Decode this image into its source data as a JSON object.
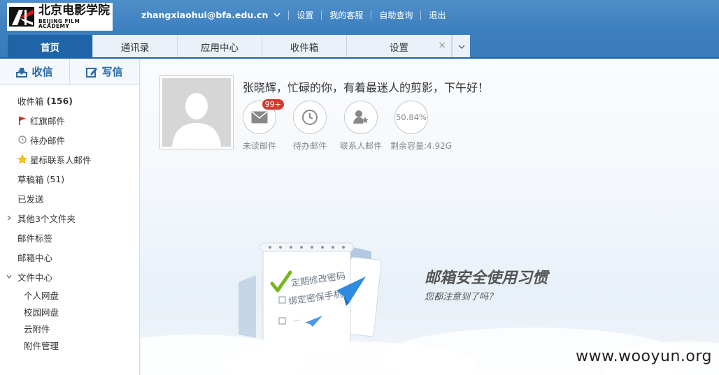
{
  "brand": {
    "name_cn": "北京电影学院",
    "name_en": "BEIJING FILM ACADEMY"
  },
  "topnav": {
    "user": "zhangxiaohui@bfa.edu.cn",
    "links": [
      "设置",
      "我的客服",
      "自助查询",
      "退出"
    ]
  },
  "tabs": [
    {
      "label": "首页",
      "active": true
    },
    {
      "label": "通讯录",
      "active": false
    },
    {
      "label": "应用中心",
      "active": false
    },
    {
      "label": "收件箱",
      "active": false
    },
    {
      "label": "设置",
      "active": false,
      "closable": true
    }
  ],
  "sidebar": {
    "receive": "收信",
    "compose": "写信",
    "folders": [
      {
        "name": "收件箱",
        "count": "(156)",
        "icon": "none"
      },
      {
        "name": "红旗邮件",
        "icon": "red-flag-icon"
      },
      {
        "name": "待办邮件",
        "icon": "clock-icon"
      },
      {
        "name": "星标联系人邮件",
        "icon": "star-icon"
      },
      {
        "name": "草稿箱",
        "count": "(51)",
        "icon": "none"
      },
      {
        "name": "已发送",
        "icon": "none"
      },
      {
        "name": "其他3个文件夹",
        "icon": "chevron-right-icon"
      },
      {
        "name": "邮件标签",
        "icon": "none"
      },
      {
        "name": "邮箱中心",
        "icon": "none"
      },
      {
        "name": "文件中心",
        "icon": "chevron-down-icon"
      }
    ],
    "file_center_items": [
      "个人网盘",
      "校园网盘",
      "云附件",
      "附件管理"
    ]
  },
  "main": {
    "greeting": "张晓辉，忙碌的你，有着最迷人的剪影，下午好！",
    "stats": [
      {
        "label": "未读邮件",
        "icon": "envelope-icon",
        "badge": "99+"
      },
      {
        "label": "待办邮件",
        "icon": "clock-icon"
      },
      {
        "label": "联系人邮件",
        "icon": "contact-star-icon"
      },
      {
        "label": "剩余容量:4.92G",
        "value": "50.84%"
      }
    ],
    "promo": {
      "title": "邮箱安全使用习惯",
      "subtitle": "您都注意到了吗？",
      "checklist": [
        "定期修改密码",
        "绑定密保手机"
      ]
    }
  },
  "watermark": "www.wooyun.org",
  "colors": {
    "header": "#3c7fbf",
    "active_tab": "#1f64a6",
    "badge": "#d43b30"
  }
}
